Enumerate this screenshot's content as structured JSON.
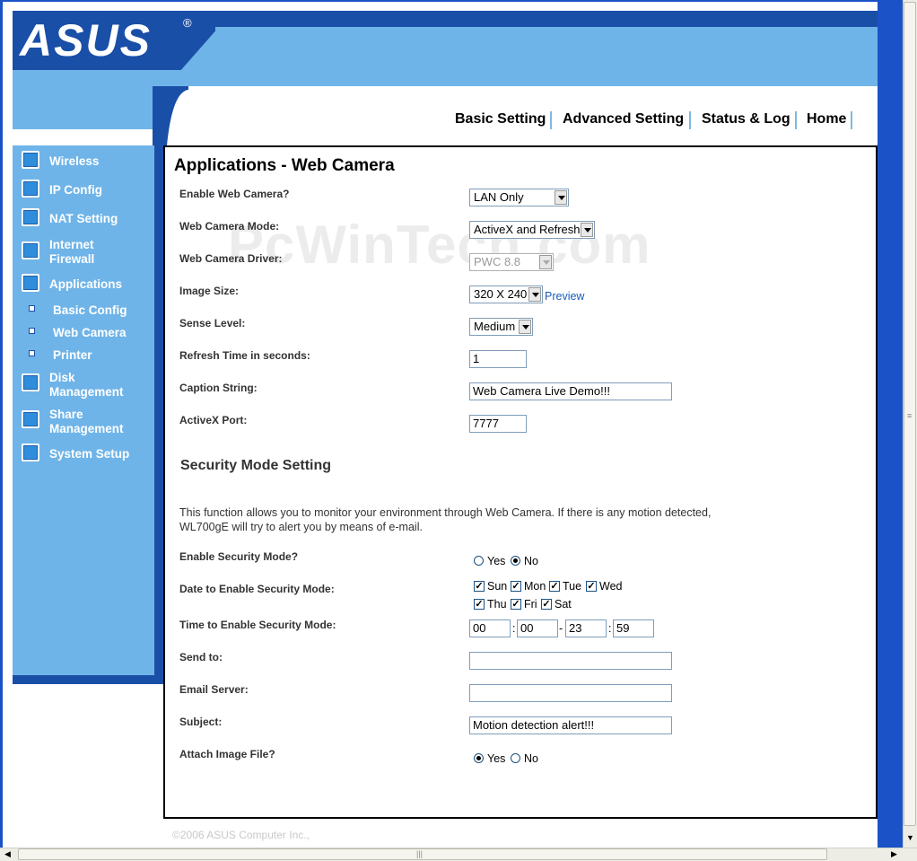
{
  "brand": {
    "logo_text": "ASUS",
    "registered": "®"
  },
  "top_nav": [
    "Basic Setting",
    "Advanced Setting",
    "Status & Log",
    "Home"
  ],
  "sidebar": {
    "items": [
      {
        "label": "Wireless"
      },
      {
        "label": "IP Config"
      },
      {
        "label": "NAT Setting"
      },
      {
        "label": "Internet Firewall"
      },
      {
        "label": "Applications"
      },
      {
        "label": "Disk Management"
      },
      {
        "label": "Share Management"
      },
      {
        "label": "System Setup"
      }
    ],
    "subitems": [
      "Basic Config",
      "Web Camera",
      "Printer"
    ]
  },
  "page": {
    "title": "Applications - Web Camera",
    "fields": {
      "enable_webcam": {
        "label": "Enable Web Camera?",
        "value": "LAN Only"
      },
      "webcam_mode": {
        "label": "Web Camera Mode:",
        "value": "ActiveX and Refresh"
      },
      "webcam_driver": {
        "label": "Web Camera Driver:",
        "value": "PWC 8.8"
      },
      "image_size": {
        "label": "Image Size:",
        "value": "320 X 240",
        "link": "Preview"
      },
      "sense_level": {
        "label": "Sense Level:",
        "value": "Medium"
      },
      "refresh_time": {
        "label": "Refresh Time in seconds:",
        "value": "1"
      },
      "caption": {
        "label": "Caption String:",
        "value": "Web Camera Live Demo!!!"
      },
      "activex_port": {
        "label": "ActiveX Port:",
        "value": "7777"
      }
    },
    "security": {
      "heading": "Security Mode Setting",
      "description": "This function allows you to monitor your environment through Web Camera. If there is any motion detected, WL700gE will try to alert you by means of e-mail.",
      "enable_security": {
        "label": "Enable Security Mode?",
        "options": [
          "Yes",
          "No"
        ],
        "selected": "No"
      },
      "days": {
        "label": "Date to Enable Security Mode:",
        "options": [
          "Sun",
          "Mon",
          "Tue",
          "Wed",
          "Thu",
          "Fri",
          "Sat"
        ],
        "checked": [
          true,
          true,
          true,
          true,
          true,
          true,
          true
        ]
      },
      "time": {
        "label": "Time to Enable Security Mode:",
        "values": [
          "00",
          "00",
          "23",
          "59"
        ],
        "sep1": ":",
        "sep2": "-",
        "sep3": ":"
      },
      "send_to": {
        "label": "Send to:",
        "value": ""
      },
      "email_server": {
        "label": "Email Server:",
        "value": ""
      },
      "subject": {
        "label": "Subject:",
        "value": "Motion detection alert!!!"
      },
      "attach": {
        "label": "Attach Image File?",
        "options": [
          "Yes",
          "No"
        ],
        "selected": "Yes"
      }
    }
  },
  "footer": "©2006 ASUS Computer Inc.,",
  "watermark": "PcWinTech.com",
  "colors": {
    "dark_blue": "#1a4fa8",
    "light_blue": "#6fb4e8",
    "frame_blue": "#1c52c8"
  }
}
